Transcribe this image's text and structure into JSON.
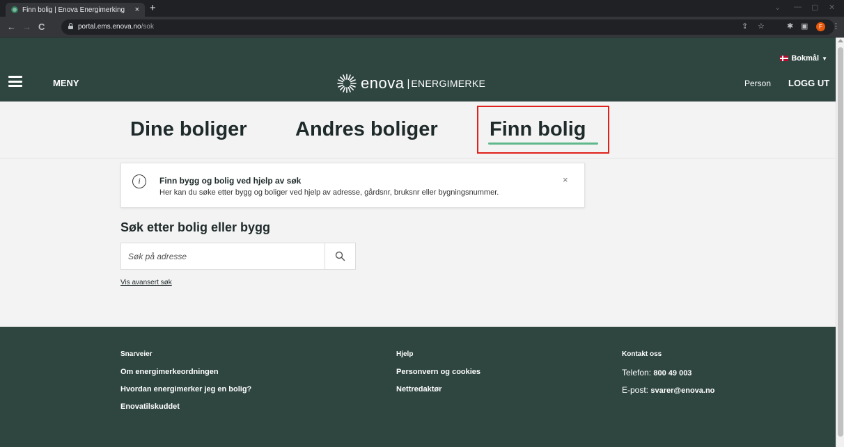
{
  "browser": {
    "tab_title": "Finn bolig | Enova Energimerking",
    "tab_close": "×",
    "new_tab": "+",
    "url_host": "portal.ems.enova.no",
    "url_path": "/sok",
    "profile_initial": "F"
  },
  "header": {
    "language": "Bokmål",
    "menu_label": "MENY",
    "logo_word": "enova",
    "logo_separator": "|",
    "logo_sub": "ENERGIMERKE",
    "person": "Person",
    "logout": "LOGG UT"
  },
  "tabs": [
    {
      "label": "Dine boliger"
    },
    {
      "label": "Andres boliger"
    },
    {
      "label": "Finn bolig",
      "active": true
    }
  ],
  "info": {
    "title": "Finn bygg og bolig ved hjelp av søk",
    "text": "Her kan du søke etter bygg og boliger ved hjelp av adresse, gårdsnr, bruksnr eller bygningsnummer.",
    "close": "×"
  },
  "search": {
    "heading": "Søk etter bolig eller bygg",
    "placeholder": "Søk på adresse",
    "advanced_link": "Vis avansert søk"
  },
  "footer": {
    "col1": {
      "heading": "Snarveier",
      "links": [
        "Om energimerkeordningen",
        "Hvordan energimerker jeg en bolig?",
        "Enovatilskuddet"
      ]
    },
    "col2": {
      "heading": "Hjelp",
      "links": [
        "Personvern og cookies",
        "Nettredaktør"
      ]
    },
    "col3": {
      "heading": "Kontakt oss",
      "phone_label": "Telefon:",
      "phone": "800 49 003",
      "email_label": "E-post:",
      "email": "svarer@enova.no"
    }
  },
  "colors": {
    "header_bg": "#2f4640",
    "active_underline": "#5fb88c",
    "highlight_box": "#e0201a",
    "page_bg": "#f3f3f3"
  }
}
